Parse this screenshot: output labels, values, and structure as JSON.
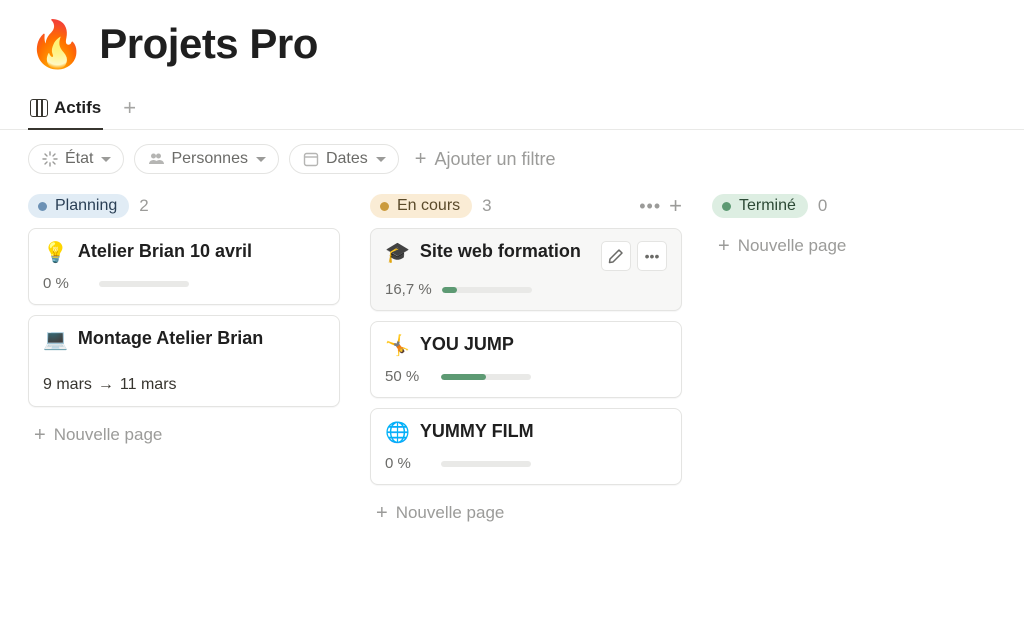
{
  "header": {
    "icon": "🔥",
    "title": "Projets Pro"
  },
  "views": {
    "active_tab_label": "Actifs"
  },
  "filters": {
    "state_label": "État",
    "people_label": "Personnes",
    "dates_label": "Dates",
    "add_filter_label": "Ajouter un filtre"
  },
  "board": {
    "new_page_label": "Nouvelle page",
    "columns": [
      {
        "status_label": "Planning",
        "count": "2",
        "color": "blue",
        "show_actions": false,
        "cards": [
          {
            "emoji": "💡",
            "title": "Atelier Brian 10 avril",
            "progress_pct": "0 %",
            "progress_width": "0%",
            "hovered": false,
            "date_from": "",
            "date_to": ""
          },
          {
            "emoji": "💻",
            "title": "Montage Atelier Brian",
            "progress_pct": "",
            "progress_width": "",
            "hovered": false,
            "date_from": "9 mars",
            "date_to": "11 mars"
          }
        ]
      },
      {
        "status_label": "En cours",
        "count": "3",
        "color": "yellow",
        "show_actions": true,
        "cards": [
          {
            "emoji": "🎓",
            "title": "Site web formation",
            "progress_pct": "16,7 %",
            "progress_width": "16.7%",
            "hovered": true,
            "date_from": "",
            "date_to": ""
          },
          {
            "emoji": "🤸",
            "title": "YOU JUMP",
            "progress_pct": "50 %",
            "progress_width": "50%",
            "hovered": false,
            "date_from": "",
            "date_to": ""
          },
          {
            "emoji": "🌐",
            "title": "YUMMY FILM",
            "progress_pct": "0 %",
            "progress_width": "0%",
            "hovered": false,
            "date_from": "",
            "date_to": ""
          }
        ]
      },
      {
        "status_label": "Terminé",
        "count": "0",
        "color": "green",
        "show_actions": false,
        "cards": []
      }
    ]
  }
}
